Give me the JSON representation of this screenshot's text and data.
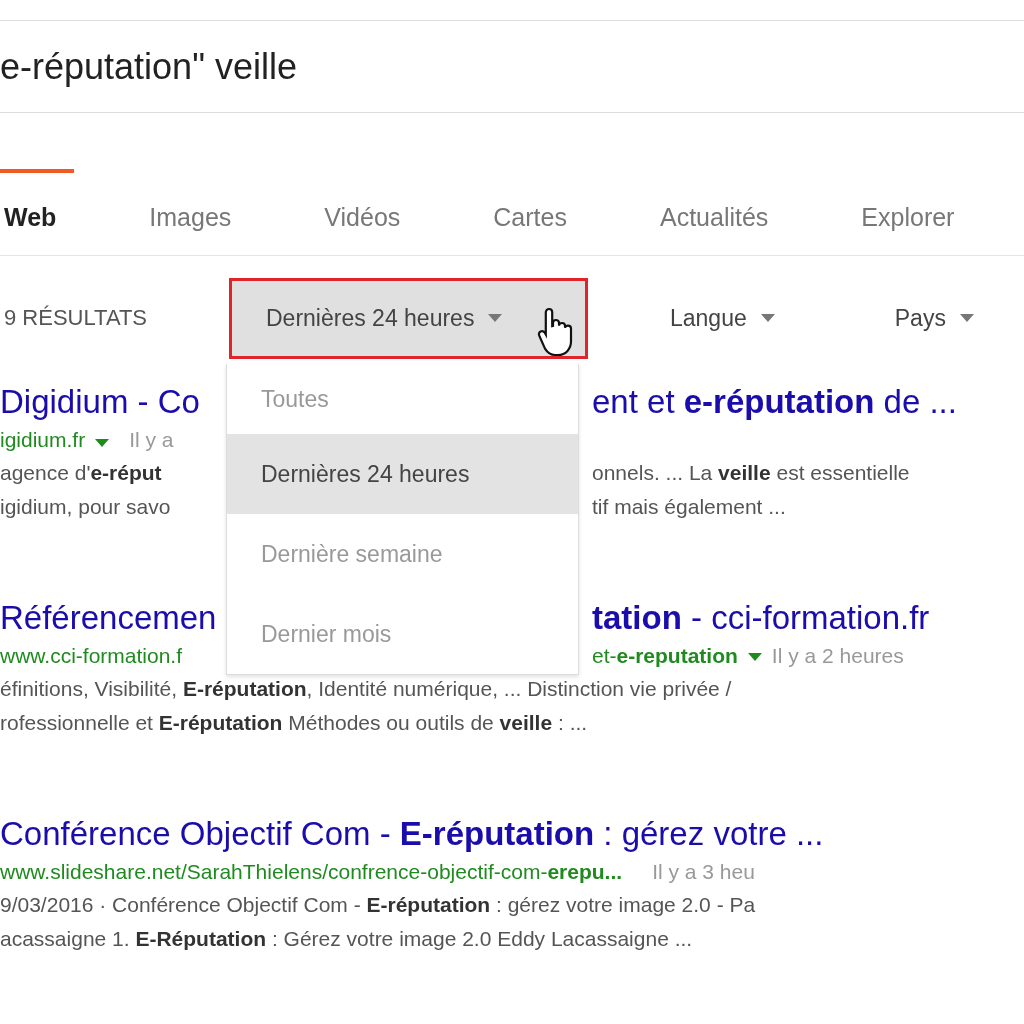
{
  "search": {
    "value": "e-réputation\" veille"
  },
  "tabs": [
    {
      "label": "Web",
      "selected": true
    },
    {
      "label": "Images",
      "selected": false
    },
    {
      "label": "Vidéos",
      "selected": false
    },
    {
      "label": "Cartes",
      "selected": false
    },
    {
      "label": "Actualités",
      "selected": false
    },
    {
      "label": "Explorer",
      "selected": false
    }
  ],
  "filters": {
    "count": "9 RÉSULTATS",
    "time_filter": {
      "label": "Dernières 24 heures",
      "expanded": true
    },
    "language_filter": "Langue",
    "country_filter": "Pays"
  },
  "time_menu": [
    {
      "label": "Toutes",
      "selected": false
    },
    {
      "label": "Dernières 24 heures",
      "selected": true
    },
    {
      "label": "Dernière semaine",
      "selected": false
    },
    {
      "label": "Dernier mois",
      "selected": false
    }
  ],
  "results": [
    {
      "title": {
        "left": "Digidium - Co",
        "right": "ent et **e-réputation** de ..."
      },
      "url": {
        "left": "igidium.fr"
      },
      "age": "Il y a",
      "snippet": [
        {
          "left": "agence d'**e-réput**",
          "right": "onnels. ... La **veille** est essentielle"
        },
        {
          "left": "igidium, pour savo",
          "right": "tif mais également ..."
        }
      ]
    },
    {
      "title": {
        "left": "Référencemen",
        "right": "**tation** - cci-formation.fr"
      },
      "url": {
        "left": "www.cci-formation.f",
        "right": "et-**e-reputation**"
      },
      "age": "Il y a 2 heures",
      "snippet": [
        {
          "left": "éfinitions, Visibilité, **E-réputation**, Identité numérique, ... Distinction vie privée /"
        },
        {
          "left": "rofessionnelle et **E-réputation** Méthodes ou outils de **veille** : ..."
        }
      ]
    },
    {
      "title": {
        "left": "Conférence Objectif Com - **E-réputation** : gérez votre ..."
      },
      "url": {
        "left": "www.slideshare.net/SarahThielens/confrence-objectif-com-**erepu...**"
      },
      "age": "Il y a 3 heu",
      "snippet": [
        {
          "left": "9/03/2016 · Conférence Objectif Com - **E-réputation** : gérez votre image 2.0 - Pa"
        },
        {
          "left": "acassaigne 1. **E-Réputation** : Gérez votre image 2.0 Eddy Lacassaigne ..."
        }
      ]
    }
  ]
}
